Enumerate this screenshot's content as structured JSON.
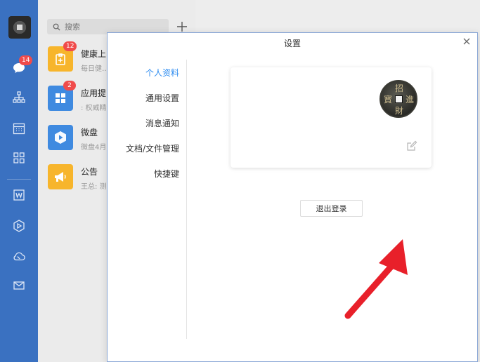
{
  "rail": {
    "chat_badge": "14"
  },
  "search": {
    "placeholder": "搜索"
  },
  "conversations": [
    {
      "name": "健康上…",
      "preview": "每日健…",
      "badge": "12",
      "color": "#f7b52c",
      "icon": "clipboard-plus-icon"
    },
    {
      "name": "应用提…",
      "preview": ": 权威精…",
      "badge": "2",
      "color": "#3f8ae0",
      "icon": "grid-apps-icon"
    },
    {
      "name": "微盘",
      "preview": "微盘4月…",
      "badge": "",
      "color": "#3f8ae0",
      "icon": "cloud-drive-icon"
    },
    {
      "name": "公告",
      "preview": "王总: 测…",
      "badge": "",
      "color": "#f7b52c",
      "icon": "megaphone-icon"
    }
  ],
  "dialog": {
    "title": "设置",
    "nav": [
      "个人资料",
      "通用设置",
      "消息通知",
      "文档/文件管理",
      "快捷键"
    ],
    "active_index": 0,
    "logout_label": "退出登录"
  },
  "colors": {
    "rail_bg": "#3a71c1",
    "accent": "#2d8cf0",
    "badge": "#f04b4b",
    "arrow": "#e8202a"
  }
}
